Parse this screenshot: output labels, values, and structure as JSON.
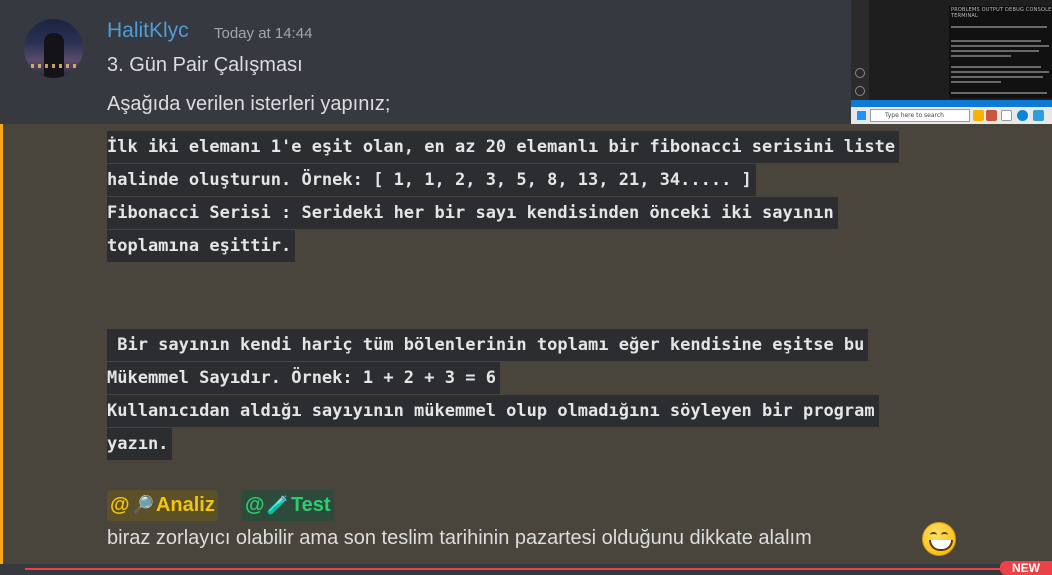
{
  "message": {
    "username": "HalitKlyc",
    "timestamp": "Today at 14:44",
    "line1": "3. Gün Pair Çalışması",
    "line2": "Aşağıda verilen isterleri yapınız;",
    "code_blocks": [
      "İlk iki elemanı 1'e eşit olan, en az 20 elemanlı bir fibonacci serisini liste",
      "halinde oluşturun. Örnek: [ 1, 1, 2, 3, 5, 8, 13, 21, 34..... ]",
      "Fibonacci Serisi : Serideki her bir sayı kendisinden önceki iki sayının",
      "toplamına eşittir.",
      " Bir sayının kendi hariç tüm bölenlerinin toplamı eğer kendisine eşitse bu",
      "Mükemmel Sayıdır. Örnek: 1 + 2 + 3 = 6",
      "Kullanıcıdan aldığı sayıyının mükemmel olup olmadığını söyleyen bir program",
      "yazın."
    ],
    "roles": [
      {
        "at": "@",
        "emoji": "🔎",
        "label": "Analiz",
        "color": "#f1c40f"
      },
      {
        "at": "@",
        "emoji": "🧪",
        "label": "Test",
        "color": "#2ecc71"
      }
    ],
    "last_line": "biraz zorlayıcı olabilir ama son teslim tarihinin pazartesi olduğunu dikkate alalım",
    "emoji_end": "grinning-face"
  },
  "thumbnail": {
    "terminal_tabs": "PROBLEMS   OUTPUT   DEBUG CONSOLE   TERMINAL",
    "search_placeholder": "Type here to search"
  },
  "badge": {
    "label": "NEW"
  },
  "colors": {
    "background": "#36393f",
    "mention_background": "#49443c",
    "mention_bar": "#faa81a",
    "username": "#4f9dd8",
    "new_badge": "#ed4245"
  }
}
